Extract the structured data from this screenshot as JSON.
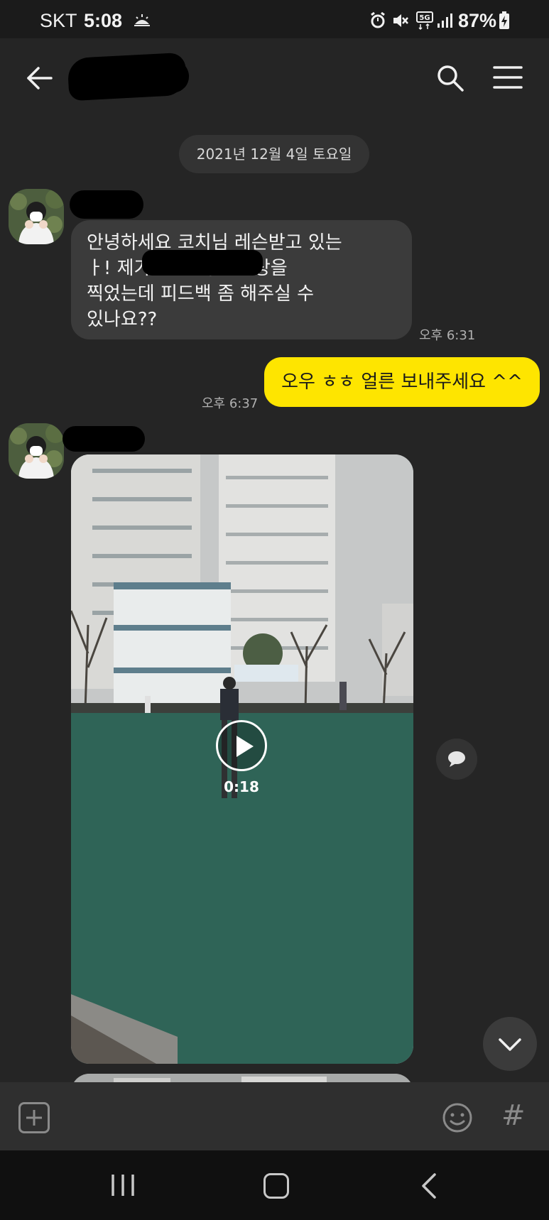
{
  "status_bar": {
    "carrier": "SKT",
    "time": "5:08",
    "battery": "87%",
    "network": "5G",
    "icons": [
      "weather-icon",
      "alarm-icon",
      "mute-icon",
      "signal-icon",
      "battery-icon"
    ]
  },
  "header": {
    "back_icon": "arrow-left-icon",
    "search_icon": "search-icon",
    "menu_icon": "hamburger-menu-icon"
  },
  "date_divider": "2021년 12월 4일 토요일",
  "messages": [
    {
      "direction": "incoming",
      "text": "안녕하세요 코치님 레슨받고 있는\n                    ㅏ! 제가 공 던지는 영상을\n찍었는데 피드백 좀 해주실 수\n있나요??",
      "time": "오후 6:31"
    },
    {
      "direction": "outgoing",
      "text": "오우 ㅎㅎ 얼른 보내주세요 ^^",
      "time": "오후 6:37"
    },
    {
      "direction": "incoming",
      "type": "video",
      "duration": "0:18"
    }
  ],
  "input_bar": {
    "plus_icon": "plus-square-icon",
    "emoji_icon": "emoji-icon",
    "hash_label": "#"
  },
  "colors": {
    "background": "#252525",
    "incoming_bubble": "#3b3b3b",
    "outgoing_bubble": "#fee500"
  }
}
